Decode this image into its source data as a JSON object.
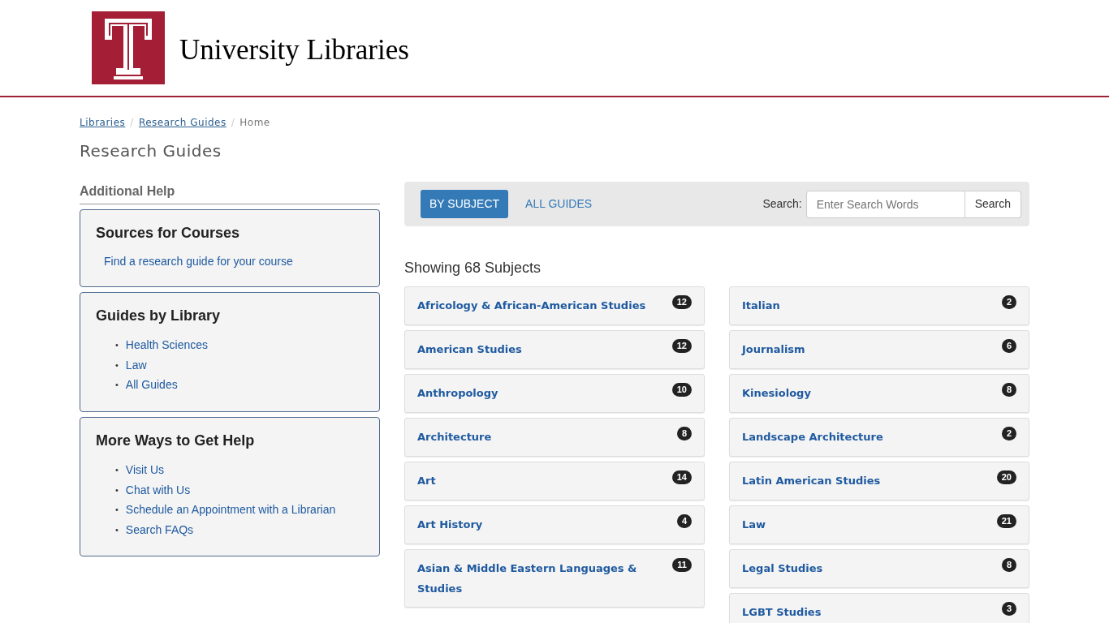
{
  "header": {
    "title": "University Libraries"
  },
  "breadcrumb": [
    {
      "label": "Libraries",
      "link": true
    },
    {
      "separator": "/",
      "label": "Research Guides",
      "link": true
    },
    {
      "separator": "/",
      "label": "Home",
      "link": false
    }
  ],
  "page_title": "Research Guides",
  "sidebar": {
    "heading": "Additional Help",
    "panels": [
      {
        "title": "Sources for Courses",
        "kind": "plain",
        "links": [
          "Find a research guide for your course"
        ]
      },
      {
        "title": "Guides by Library",
        "kind": "bullets",
        "marker": "•",
        "links": [
          "Health Sciences",
          "Law",
          "All Guides"
        ]
      },
      {
        "title": "More Ways to Get Help",
        "kind": "bullets",
        "marker": "•",
        "links": [
          "Visit Us",
          "Chat with Us",
          "Schedule an Appointment with a Librarian",
          "Search FAQs"
        ]
      }
    ]
  },
  "tabs": [
    {
      "label": "BY SUBJECT",
      "selected": true
    },
    {
      "label": "ALL GUIDES",
      "selected": false
    }
  ],
  "search": {
    "label": "Search:",
    "placeholder": "Enter Search Words",
    "button": "Search"
  },
  "showing": "Showing 68 Subjects",
  "subject_columns": [
    [
      {
        "name": "Africology & African-American Studies",
        "count": "12"
      },
      {
        "name": "American Studies",
        "count": "12"
      },
      {
        "name": "Anthropology",
        "count": "10"
      },
      {
        "name": "Architecture",
        "count": "8"
      },
      {
        "name": "Art",
        "count": "14"
      },
      {
        "name": "Art History",
        "count": "4"
      },
      {
        "name": "Asian & Middle Eastern Languages & Studies",
        "count": "11"
      }
    ],
    [
      {
        "name": "Italian",
        "count": "2"
      },
      {
        "name": "Journalism",
        "count": "6"
      },
      {
        "name": "Kinesiology",
        "count": "8"
      },
      {
        "name": "Landscape Architecture",
        "count": "2"
      },
      {
        "name": "Latin American Studies",
        "count": "20"
      },
      {
        "name": "Law",
        "count": "21"
      },
      {
        "name": "Legal Studies",
        "count": "8"
      },
      {
        "name": "LGBT Studies",
        "count": "3"
      }
    ]
  ]
}
